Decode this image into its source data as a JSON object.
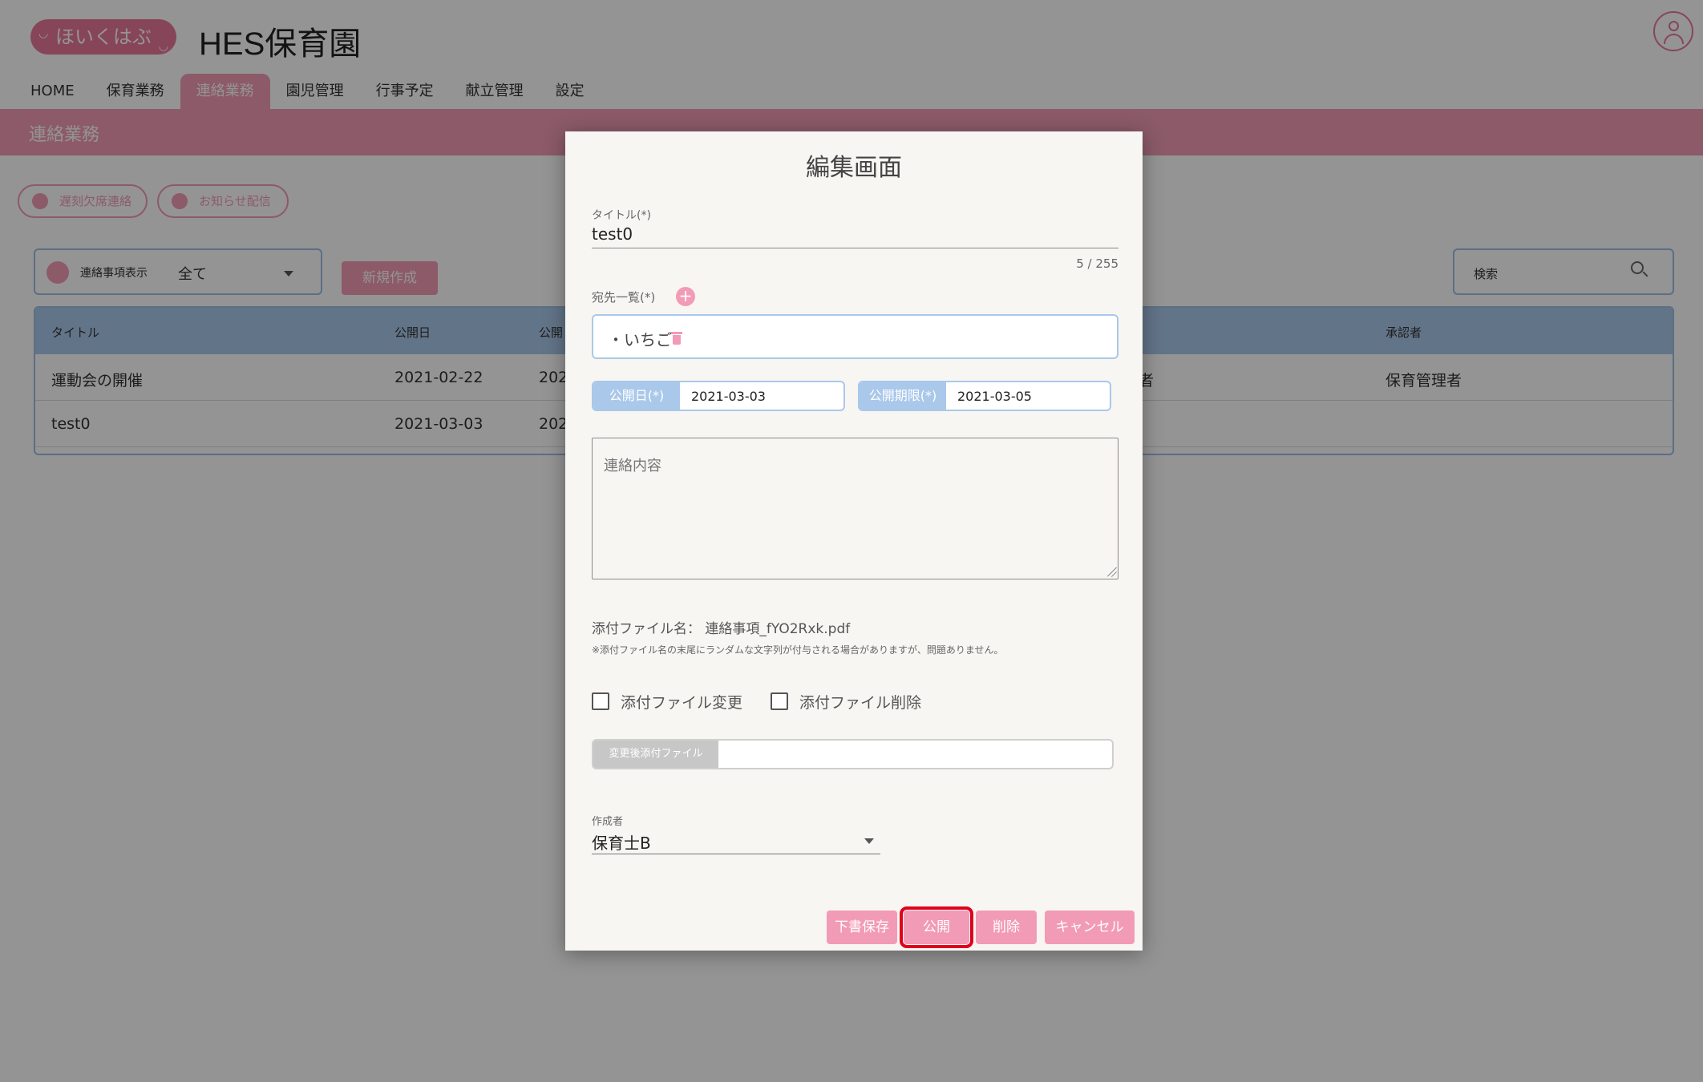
{
  "app": {
    "logo_text": "ほいくはぶ",
    "site_title": "HES保育園"
  },
  "nav": {
    "items": [
      {
        "label": "HOME"
      },
      {
        "label": "保育業務"
      },
      {
        "label": "連絡業務"
      },
      {
        "label": "園児管理"
      },
      {
        "label": "行事予定"
      },
      {
        "label": "献立管理"
      },
      {
        "label": "設定"
      }
    ],
    "active": "連絡業務"
  },
  "section": {
    "title": "連絡業務",
    "pills": [
      {
        "label": "遅刻欠席連絡"
      },
      {
        "label": "お知らせ配信"
      }
    ]
  },
  "filter": {
    "label": "連絡事項表示",
    "value": "全て"
  },
  "new_button": "新規作成",
  "search": {
    "label": "検索"
  },
  "table": {
    "headers": [
      "タイトル",
      "公開日",
      "公開",
      "承認者"
    ],
    "rows": [
      {
        "title": "運動会の開催",
        "date": "2021-02-22",
        "end": "202",
        "creator": "者",
        "approver": "保育管理者"
      },
      {
        "title": "test0",
        "date": "2021-03-03",
        "end": "202",
        "creator": "",
        "approver": ""
      }
    ]
  },
  "modal": {
    "title": "編集画面",
    "title_field": {
      "label": "タイトル(*)",
      "value": "test0",
      "counter": "5 / 255"
    },
    "destinations": {
      "label": "宛先一覧(*)",
      "items": [
        "・いちご"
      ]
    },
    "publish_date": {
      "label": "公開日(*)",
      "value": "2021-03-03"
    },
    "publish_limit": {
      "label": "公開期限(*)",
      "value": "2021-03-05"
    },
    "content": {
      "placeholder": "連絡内容"
    },
    "attachment": {
      "name_text": "添付ファイル名： 連絡事項_fYO2Rxk.pdf",
      "note": "※添付ファイル名の末尾にランダムな文字列が付与される場合がありますが、問題ありません。",
      "change_label": "添付ファイル変更",
      "delete_label": "添付ファイル削除",
      "file_tag": "変更後添付ファイル"
    },
    "author": {
      "label": "作成者",
      "value": "保育士B"
    },
    "buttons": {
      "draft": "下書保存",
      "publish": "公開",
      "delete": "削除",
      "cancel": "キャンセル"
    }
  },
  "colors": {
    "accent_pink": "#f29bb6",
    "accent_blue": "#a9c8ea",
    "highlight_red": "#e0001c"
  }
}
